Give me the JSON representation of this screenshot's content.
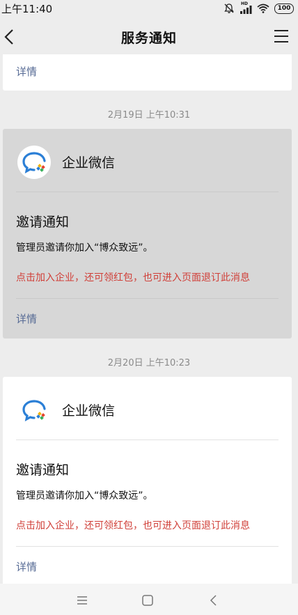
{
  "status_bar": {
    "time": "上午11:40",
    "network": "HD",
    "battery": "100"
  },
  "nav": {
    "title": "服务通知"
  },
  "top_card": {
    "details": "详情"
  },
  "messages": [
    {
      "timestamp": "2月19日 上午10:31",
      "app_name": "企业微信",
      "title": "邀请通知",
      "body": "管理员邀请你加入“博众致远”。",
      "link": "点击加入企业，还可领红包，也可进入页面退订此消息",
      "details": "详情"
    },
    {
      "timestamp": "2月20日 上午10:23",
      "app_name": "企业微信",
      "title": "邀请通知",
      "body": "管理员邀请你加入“博众致远”。",
      "link": "点击加入企业，还可领红包，也可进入页面退订此消息",
      "details": "详情"
    }
  ],
  "colors": {
    "link": "#576b95",
    "alert": "#d03f38",
    "background": "#ededed"
  },
  "icons": [
    "mute-icon",
    "signal-icon",
    "wifi-icon",
    "battery-icon",
    "back-icon",
    "menu-icon",
    "wecom-logo-icon",
    "nav-menu-icon",
    "nav-home-icon",
    "nav-back-icon"
  ]
}
